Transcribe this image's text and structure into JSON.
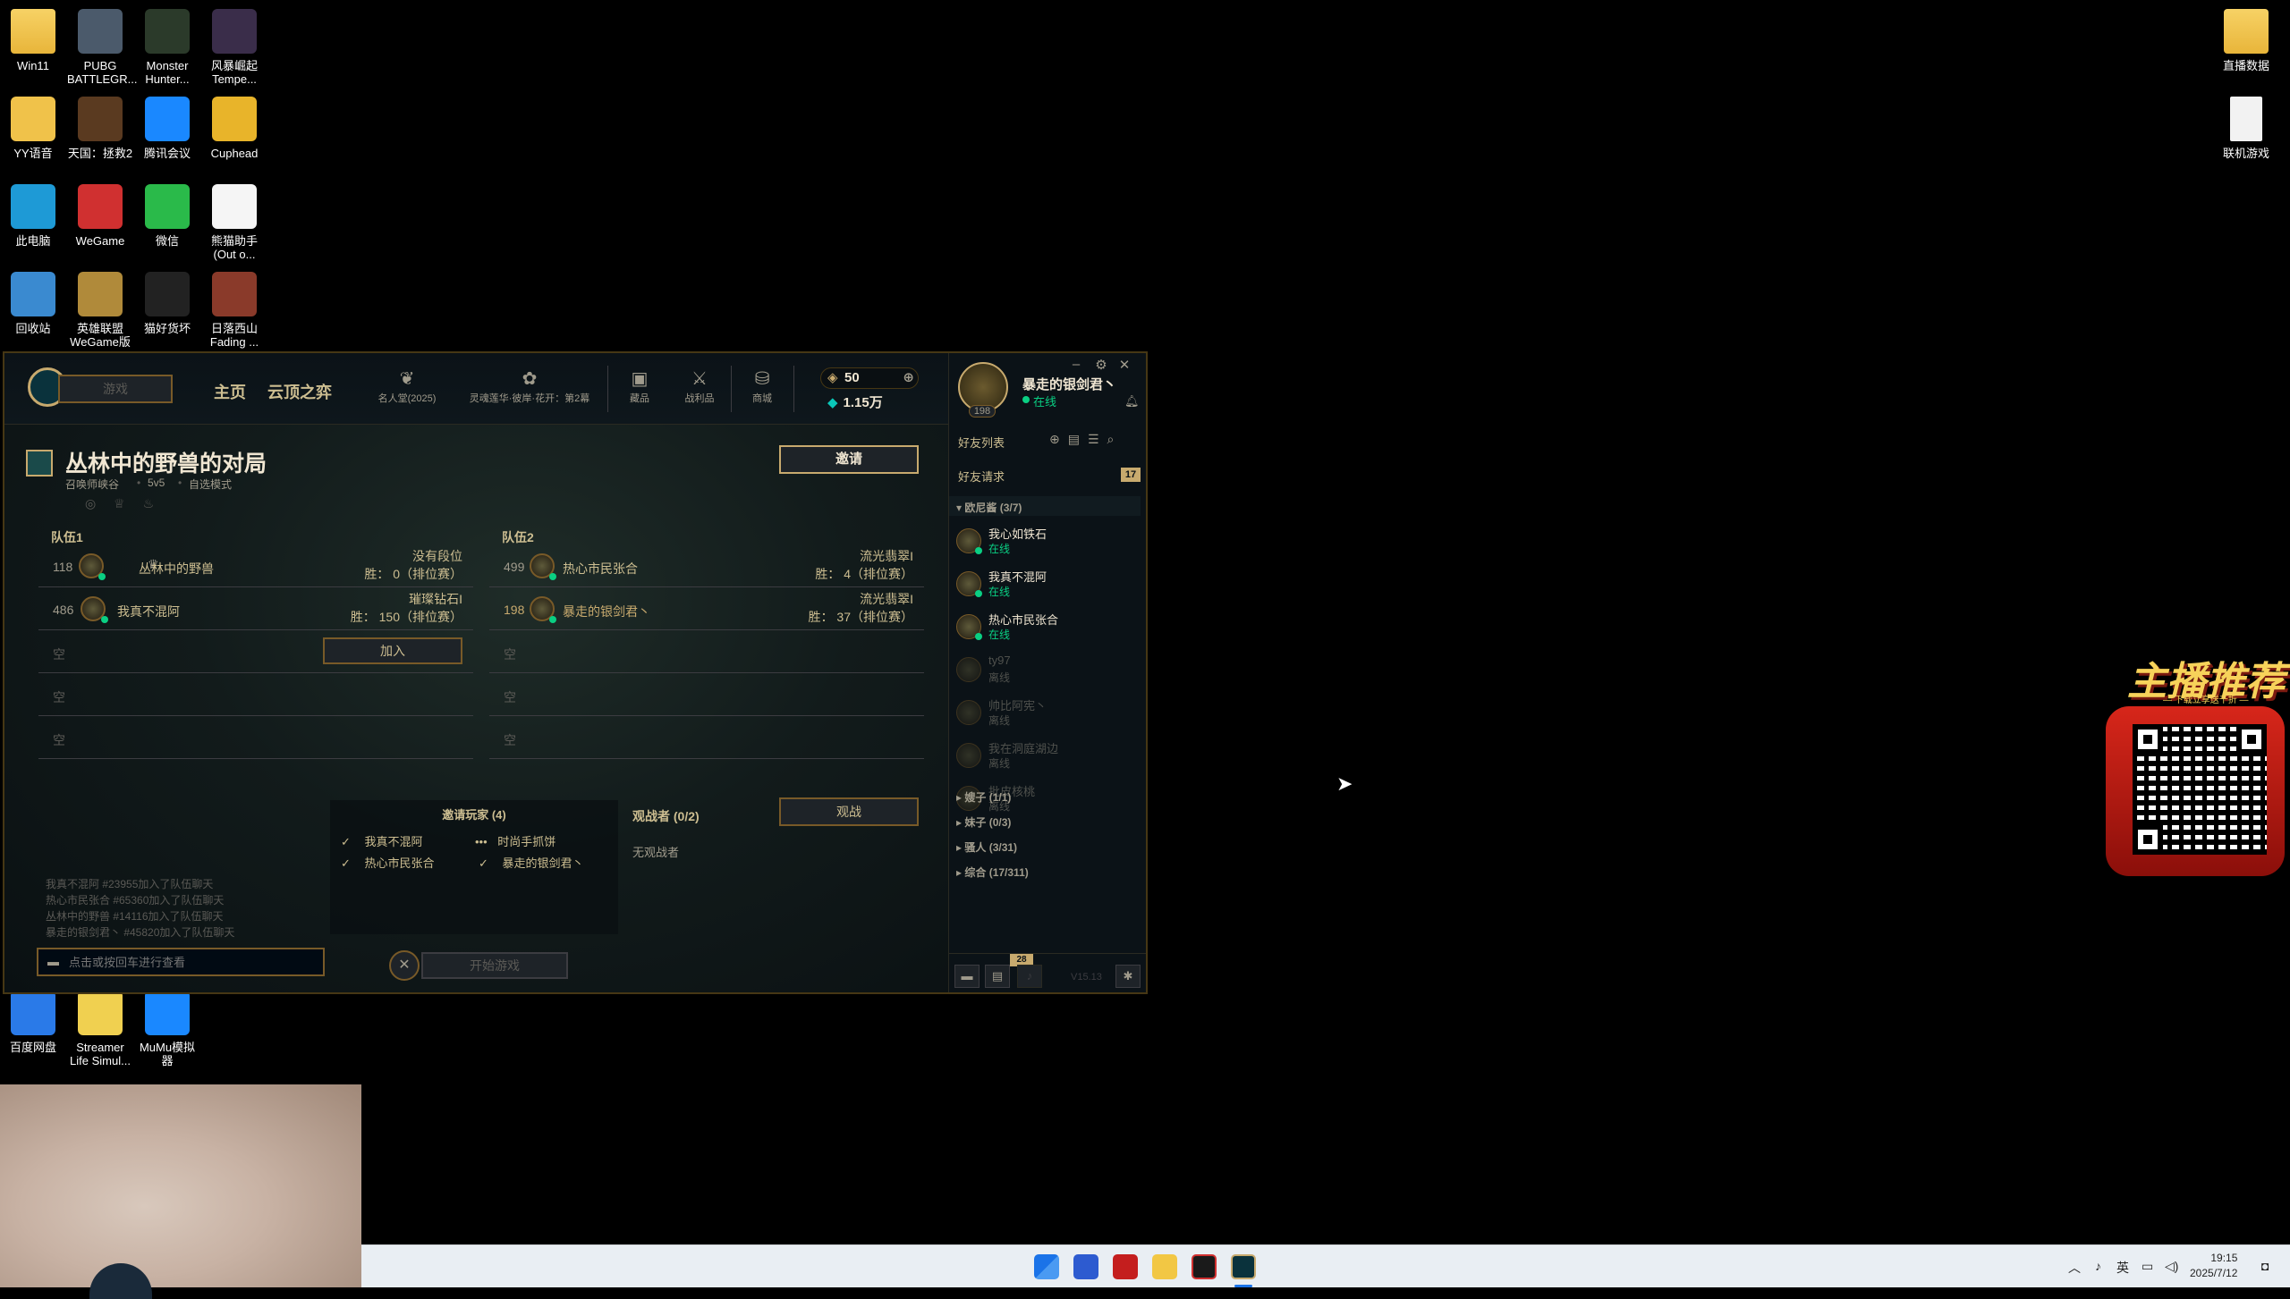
{
  "desktop": {
    "icons_left": [
      {
        "label": "Win11",
        "type": "folder"
      },
      {
        "label": "PUBG BATTLEGR...",
        "type": "app"
      },
      {
        "label": "Monster Hunter...",
        "type": "app"
      },
      {
        "label": "风暴崛起 Tempe...",
        "type": "app"
      },
      {
        "label": "YY语音",
        "type": "app"
      },
      {
        "label": "天国：拯救2",
        "type": "app"
      },
      {
        "label": "腾讯会议",
        "type": "app"
      },
      {
        "label": "Cuphead",
        "type": "app"
      },
      {
        "label": "此电脑",
        "type": "app"
      },
      {
        "label": "WeGame",
        "type": "app"
      },
      {
        "label": "微信",
        "type": "app"
      },
      {
        "label": "熊猫助手 (Out o...",
        "type": "app"
      },
      {
        "label": "回收站",
        "type": "app"
      },
      {
        "label": "英雄联盟 WeGame版",
        "type": "app"
      },
      {
        "label": "猫好货坏",
        "type": "app"
      },
      {
        "label": "日落西山 Fading ...",
        "type": "app"
      },
      {
        "label": "百度网盘",
        "type": "app"
      },
      {
        "label": "Streamer Life Simul...",
        "type": "app"
      },
      {
        "label": "MuMu模拟器",
        "type": "app"
      }
    ],
    "icons_right": [
      {
        "label": "直播数据",
        "type": "folder"
      },
      {
        "label": "联机游戏",
        "type": "file"
      }
    ]
  },
  "client": {
    "play_button": "游戏",
    "nav": {
      "home": "主页",
      "tft": "云顶之弈"
    },
    "nav_icons": [
      {
        "label": "名人堂(2025)",
        "icon": "hall-of-fame-icon"
      },
      {
        "label": "灵魂莲华·彼岸·花开：第2幕",
        "icon": "event-pass-icon"
      },
      {
        "label": "藏品",
        "icon": "collection-icon"
      },
      {
        "label": "战利品",
        "icon": "loot-icon"
      },
      {
        "label": "商城",
        "icon": "store-icon"
      }
    ],
    "currency": {
      "rp": "50",
      "be": "1.15万"
    },
    "profile": {
      "name": "暴走的银剑君丶",
      "status": "在线",
      "level": "198"
    },
    "lobby": {
      "title": "丛林中的野兽的对局",
      "map": "召唤师峡谷",
      "size": "5v5",
      "mode": "自选模式",
      "invite_label": "邀请",
      "team1_label": "队伍1",
      "team2_label": "队伍2",
      "team1": [
        {
          "level": "118",
          "name": "丛林中的野兽",
          "rank": "没有段位",
          "wins": "胜：  0（排位赛）",
          "leader": true
        },
        {
          "level": "486",
          "name": "我真不混阿",
          "rank": "璀璨钻石I",
          "wins": "胜：  150（排位赛）"
        }
      ],
      "team2": [
        {
          "level": "499",
          "name": "热心市民张合",
          "rank": "流光翡翠I",
          "wins": "胜：  4（排位赛）"
        },
        {
          "level": "198",
          "name": "暴走的银剑君丶",
          "rank": "流光翡翠I",
          "wins": "胜：  37（排位赛）"
        }
      ],
      "empty_label": "空",
      "join_label": "加入",
      "invited_title": "邀请玩家 (4)",
      "invited": [
        {
          "name": "我真不混阿",
          "state": "✓"
        },
        {
          "name": "时尚手抓饼",
          "state": "•••"
        },
        {
          "name": "热心市民张合",
          "state": "✓"
        },
        {
          "name": "暴走的银剑君丶",
          "state": "✓"
        }
      ],
      "spectators_title": "观战者 (0/2)",
      "spectators_none": "无观战者",
      "spectate_label": "观战",
      "chat_log": [
        "我真不混阿 #23955加入了队伍聊天",
        "热心市民张合 #65360加入了队伍聊天",
        "丛林中的野兽 #14116加入了队伍聊天",
        "暴走的银剑君丶 #45820加入了队伍聊天"
      ],
      "chat_placeholder": "点击或按回车进行查看",
      "start_label": "开始游戏",
      "close_label": "✕"
    },
    "friends": {
      "header": "好友列表",
      "requests_label": "好友请求",
      "requests_count": "17",
      "group_open": "欧尼酱 (3/7)",
      "list": [
        {
          "name": "我心如铁石",
          "status": "在线",
          "online": true
        },
        {
          "name": "我真不混阿",
          "status": "在线",
          "online": true
        },
        {
          "name": "热心市民张合",
          "status": "在线",
          "online": true
        },
        {
          "name": "ty97",
          "status": "离线",
          "online": false
        },
        {
          "name": "帅比阿宪丶",
          "status": "离线",
          "online": false
        },
        {
          "name": "我在洞庭湖边",
          "status": "离线",
          "online": false
        },
        {
          "name": "批皮核桃",
          "status": "离线",
          "online": false
        }
      ],
      "groups": [
        "嫂子 (1/1)",
        "妹子 (0/3)",
        "骚人 (3/31)",
        "综合 (17/311)"
      ],
      "chat_badge": "28",
      "version": "V15.13"
    }
  },
  "promo": {
    "title": "主播推荐",
    "subtitle": "— 下载立享送千折 —"
  },
  "taskbar": {
    "ime": "英",
    "time": "19:15",
    "date": "2025/7/12"
  }
}
